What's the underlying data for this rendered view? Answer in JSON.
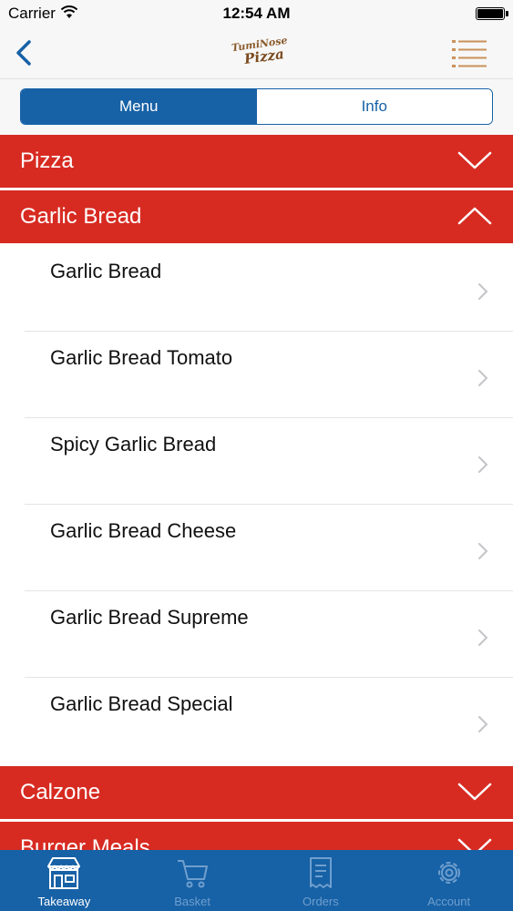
{
  "status_bar": {
    "carrier": "Carrier",
    "time": "12:54 AM"
  },
  "nav": {
    "logo_line1": "TumiNose",
    "logo_line2": "Pizza"
  },
  "segments": [
    {
      "label": "Menu",
      "active": true
    },
    {
      "label": "Info",
      "active": false
    }
  ],
  "sections": {
    "pizza": {
      "title": "Pizza",
      "expanded": false
    },
    "garlic_bread": {
      "title": "Garlic Bread",
      "expanded": true,
      "items": [
        "Garlic Bread",
        "Garlic Bread Tomato",
        "Spicy Garlic Bread",
        "Garlic Bread Cheese",
        "Garlic Bread Supreme",
        "Garlic Bread Special"
      ]
    },
    "calzone": {
      "title": "Calzone",
      "expanded": false
    },
    "burger_meals": {
      "title": "Burger Meals",
      "expanded": false
    }
  },
  "tabs": [
    {
      "label": "Takeaway",
      "icon": "storefront-icon",
      "active": true
    },
    {
      "label": "Basket",
      "icon": "cart-icon",
      "active": false
    },
    {
      "label": "Orders",
      "icon": "receipt-icon",
      "active": false
    },
    {
      "label": "Account",
      "icon": "gear-icon",
      "active": false
    }
  ],
  "colors": {
    "accent_red": "#d72b22",
    "brand_blue": "#1761a6",
    "inactive_tab": "#6f9fce"
  }
}
